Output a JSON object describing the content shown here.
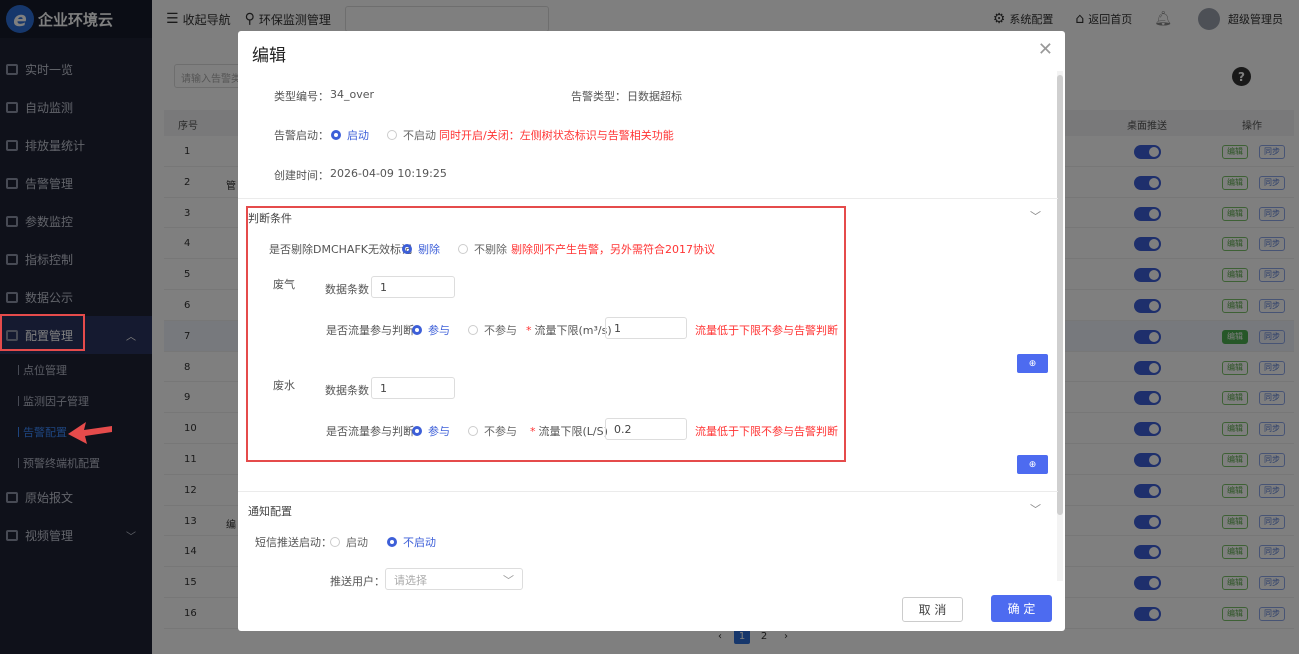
{
  "app": {
    "logo_letter": "e",
    "name": "企业环境云"
  },
  "sidebar": {
    "items": [
      {
        "label": "实时一览"
      },
      {
        "label": "自动监测"
      },
      {
        "label": "排放量统计"
      },
      {
        "label": "告警管理"
      },
      {
        "label": "参数监控"
      },
      {
        "label": "指标控制"
      },
      {
        "label": "数据公示"
      },
      {
        "label": "配置管理",
        "active": true
      },
      {
        "label": "原始报文"
      },
      {
        "label": "视频管理"
      }
    ],
    "sub_items": [
      {
        "label": "点位管理"
      },
      {
        "label": "监测因子管理"
      },
      {
        "label": "告警配置",
        "current": true
      },
      {
        "label": "预警终端机配置"
      }
    ]
  },
  "topbar": {
    "collapse_label": "收起导航",
    "module_label": "环保监测管理",
    "system_config": "系统配置",
    "back_home": "返回首页",
    "user_name": "超级管理员"
  },
  "background": {
    "search_placeholder": "请输入告警类",
    "columns": [
      "序号",
      "桌面推送",
      "操作"
    ],
    "row_numbers": [
      "1",
      "2",
      "3",
      "4",
      "5",
      "6",
      "7",
      "8",
      "9",
      "10",
      "11",
      "12",
      "13",
      "14",
      "15",
      "16"
    ],
    "row2_text": "管",
    "row13_text": "编",
    "edit_label": "编辑",
    "sync_label": "同步",
    "pages": [
      "1",
      "2"
    ],
    "prev": "‹",
    "next": "›"
  },
  "modal": {
    "title": "编辑",
    "type_code_label": "类型编号：",
    "type_code_value": "34_over",
    "alarm_type_label": "告警类型：",
    "alarm_type_value": "日数据超标",
    "alarm_enable_label": "告警启动：",
    "enable_option": "启动",
    "disable_option": "不启动",
    "alarm_enable_hint": "同时开启/关闭：左侧树状态标识与告警相关功能",
    "created_label": "创建时间：",
    "created_value": "2026-04-09 10:19:25",
    "condition_section": "判断条件",
    "dmchafk_label": "是否剔除DMCHAFK无效标记",
    "remove_option": "剔除",
    "no_remove_option": "不剔除",
    "dmchafk_hint": "剔除则不产生告警，另外需符合2017协议",
    "gas": {
      "title": "废气",
      "count_label": "数据条数",
      "count_value": "1",
      "flow_judge_label": "是否流量参与判断",
      "join_option": "参与",
      "no_join_option": "不参与",
      "lower_limit_label": "流量下限(m³/s)",
      "lower_limit_value": "1",
      "hint": "流量低于下限不参与告警判断"
    },
    "water": {
      "title": "废水",
      "count_label": "数据条数",
      "count_value": "1",
      "flow_judge_label": "是否流量参与判断",
      "join_option": "参与",
      "no_join_option": "不参与",
      "lower_limit_label": "流量下限(L/S)",
      "lower_limit_value": "0.2",
      "hint": "流量低于下限不参与告警判断"
    },
    "notify_section": "通知配置",
    "sms_label": "短信推送启动：",
    "sms_enable": "启动",
    "sms_disable": "不启动",
    "push_user_label": "推送用户：",
    "push_user_placeholder": "请选择",
    "cancel": "取 消",
    "confirm": "确 定"
  },
  "colors": {
    "accent": "#4d6bf0",
    "highlight_red": "#e54b4b",
    "sidebar_bg": "#1e2235"
  }
}
